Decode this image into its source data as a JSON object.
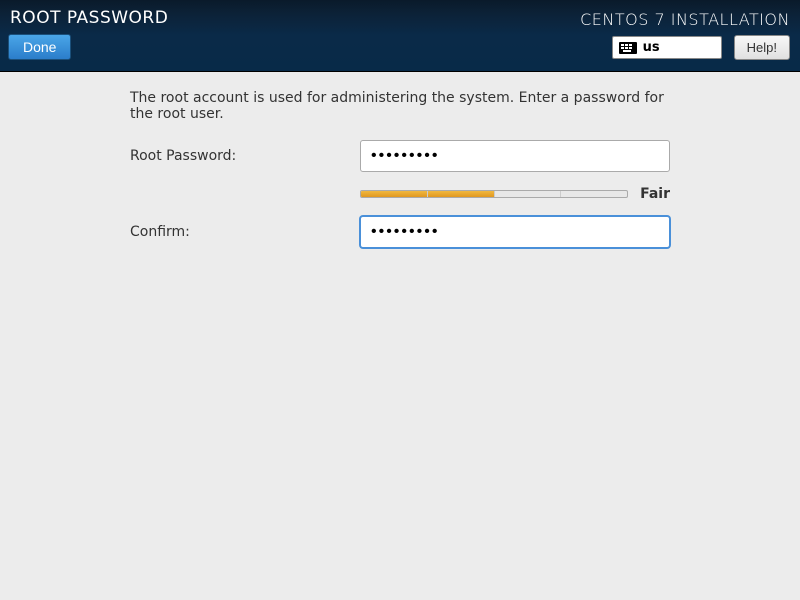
{
  "header": {
    "title": "ROOT PASSWORD",
    "done_label": "Done",
    "installer_name": "CENTOS 7 INSTALLATION",
    "keyboard_layout": "us",
    "help_label": "Help!"
  },
  "content": {
    "instruction": "The root account is used for administering the system.  Enter a password for the root user.",
    "root_password_label": "Root Password:",
    "root_password_value": "•••••••••",
    "confirm_label": "Confirm:",
    "confirm_value": "•••••••••",
    "strength": {
      "label": "Fair",
      "filled_segments": 2,
      "total_segments": 4
    }
  }
}
